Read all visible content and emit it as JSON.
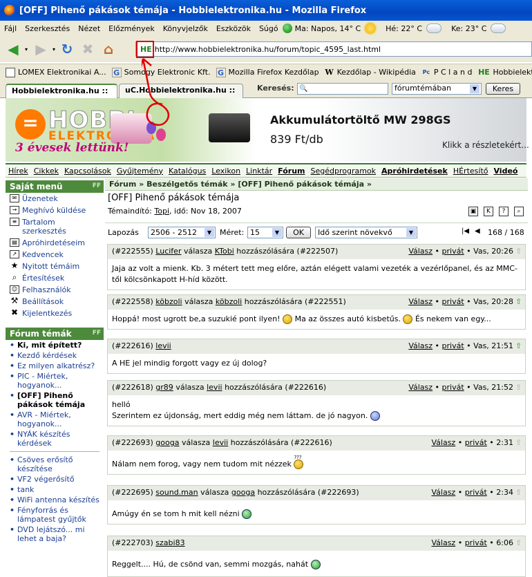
{
  "window": {
    "title": "[OFF] Pihenő pákások témája - Hobbielektronika.hu - Mozilla Firefox"
  },
  "menu": {
    "items": [
      "Fájl",
      "Szerkesztés",
      "Nézet",
      "Előzmények",
      "Könyvjelzők",
      "Eszközök",
      "Súgó"
    ],
    "weather": [
      "Ma: Napos, 14° C",
      "Hé: 22° C",
      "Ke: 23° C"
    ]
  },
  "nav": {
    "url": "http://www.hobbielektronika.hu/forum/topic_4595_last.html",
    "favicon_text": "HE"
  },
  "bookmarks": [
    {
      "icon": "lomex-icon",
      "label": "LOMEX Elektronikai A..."
    },
    {
      "icon": "google-icon",
      "icon_text": "G",
      "label": "Somogy Elektronic Kft."
    },
    {
      "icon": "google-icon",
      "icon_text": "G",
      "label": "Mozilla Firefox Kezdőlap"
    },
    {
      "icon": "wikipedia-icon",
      "icon_text": "W",
      "label": "Kezdőlap - Wikipédia"
    },
    {
      "icon": "pcland-icon",
      "icon_text": "Pc",
      "label": "P C l a n d"
    },
    {
      "icon": "he-icon",
      "icon_text": "HE",
      "label": "Hobbielektronika.hu ::"
    }
  ],
  "tabs": [
    "Hobbielektronika.hu ::",
    "uC.Hobbielektronika.hu ::"
  ],
  "search": {
    "label": "Keresés:",
    "scope": "fórumtémában",
    "button": "Keres"
  },
  "banner": {
    "logo_main": "HOBBI",
    "logo_sub": "ELEKTRONIKA",
    "anniversary": "3 évesek lettünk!",
    "product": "Akkumulátortöltő MW 298GS",
    "price": "839 Ft/db",
    "details": "Klikk a részletekért..."
  },
  "sitenav": [
    "Hírek",
    "Cikkek",
    "Kapcsolások",
    "Gyűjtemény",
    "Katalógus",
    "Lexikon",
    "Linktár",
    "Fórum",
    "Segédprogramok",
    "Apróhirdetések",
    "HÉrtesítő",
    "Videó"
  ],
  "sidebar": {
    "menu_title": "Saját menü",
    "menu": [
      {
        "icon": "envelope-icon",
        "label": "Üzenetek"
      },
      {
        "icon": "invite-icon",
        "label": "Meghívó küldése"
      },
      {
        "icon": "topics-icon",
        "label": "Tartalom szerkesztés"
      },
      {
        "icon": "ads-icon",
        "label": "Apróhirdetéseim"
      },
      {
        "icon": "favorite-icon",
        "label": "Kedvencek"
      },
      {
        "icon": "star-icon",
        "label": "Nyitott témáim"
      },
      {
        "icon": "search-icon",
        "label": "Értesítések"
      },
      {
        "icon": "users-icon",
        "label": "Felhasználók"
      },
      {
        "icon": "tools-icon",
        "label": "Beállítások"
      },
      {
        "icon": "logout-icon",
        "label": "Kijelentkezés"
      }
    ],
    "topics_title": "Fórum témák",
    "topics": [
      "Ki, mit épített?",
      "Kezdő kérdések",
      "Ez milyen alkatrész?",
      "PIC - Miértek, hogyanok...",
      "[OFF] Pihenő pákások témája",
      "AVR - Miértek, hogyanok...",
      "NYÁK készítés kérdések",
      "Csöves erősítő készítése",
      "VF2 végerősítő",
      "tank",
      "WiFi antenna készítés",
      "Fényforrás és lámpatest gyűjtők",
      "DVD lejátszó... mi lehet a baja?"
    ]
  },
  "breadcrumb": [
    "Fórum",
    "Beszélgetős témák",
    "[OFF] Pihenő pákások témája"
  ],
  "topic": {
    "title": "[OFF] Pihenő pákások témája",
    "starter_label": "Témaindító:",
    "starter": "Topi",
    "date": ", idő: Nov 18, 2007"
  },
  "pager": {
    "label": "Lapozás",
    "range": "2506 - 2512",
    "size_label": "Méret:",
    "size": "15",
    "ok": "OK",
    "order": "Idő szerint növekvő",
    "position": "168 / 168"
  },
  "post_labels": {
    "reply_to": "válasza",
    "reply_suffix": "hozzászólására",
    "reply": "Válasz",
    "private": "privát"
  },
  "posts": [
    {
      "id": "(#222555)",
      "user": "Lucifer",
      "to": "KTobi",
      "ref": "(#222507)",
      "time": "Vas, 20:26",
      "text": "Jaja az volt a mienk. Kb. 3 métert tett meg előre, aztán elégett valami vezeték a vezérlőpanel, és az MMC-től kölcsönkapott H-híd között."
    },
    {
      "id": "(#222558)",
      "user": "köbzoli",
      "to": "köbzoli",
      "ref": "(#222551)",
      "time": "Vas, 20:28",
      "text": "Hoppá! most ugrott be,a suzukié pont ilyen!",
      "text2": "Ma az összes autó kisbetűs.",
      "text3": "És nekem van egy..."
    },
    {
      "id": "(#222616)",
      "user": "levii",
      "time": "Vas, 21:51",
      "text": "A HE jel mindig forgott vagy ez új dolog?"
    },
    {
      "id": "(#222618)",
      "user": "gr89",
      "to": "levii",
      "ref": "(#222616)",
      "time": "Vas, 21:52",
      "text": "helló",
      "text2": "Szerintem ez újdonság, mert eddig még nem láttam. de jó nagyon."
    },
    {
      "id": "(#222693)",
      "user": "googa",
      "to": "levii",
      "ref": "(#222616)",
      "time": "2:31",
      "text": "Nálam nem forog, vagy nem tudom mit nézzek",
      "smiley_caption": "???"
    },
    {
      "id": "(#222695)",
      "user": "sound.man",
      "to": "googa",
      "ref": "(#222693)",
      "time": "2:34",
      "text": "Amúgy én se tom h mit kell nézni"
    },
    {
      "id": "(#222703)",
      "user": "szabi83",
      "time": "6:06",
      "text": "Reggelt.... Hú, de csönd van, semmi mozgás, nahát"
    }
  ],
  "colors": {
    "accent": "#4d8a3c",
    "link": "#1b3f93",
    "annotation": "#e00000"
  }
}
